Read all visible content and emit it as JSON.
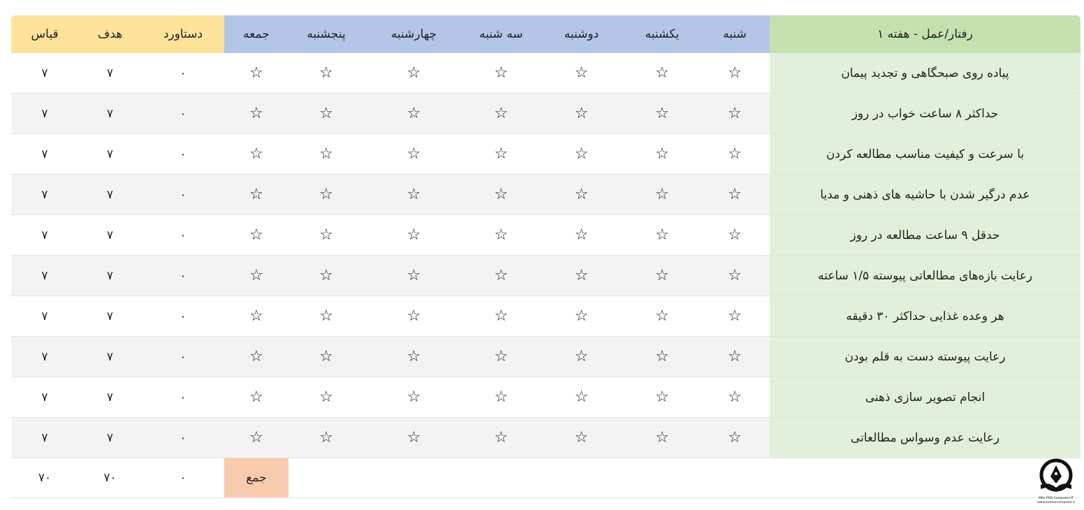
{
  "header": {
    "behavior": "رفتار/عمل - هفته ۱",
    "days": [
      "شنبه",
      "یکشنبه",
      "دوشنبه",
      "سه شنبه",
      "چهارشنبه",
      "پنجشنبه",
      "جمعه"
    ],
    "achievement": "دستاورد",
    "goal": "هدف",
    "measure": "قیاس"
  },
  "rows": [
    {
      "behavior": "پیاده روی صبحگاهی و تجدید پیمان",
      "achievement": "۰",
      "goal": "۷",
      "measure": "۷"
    },
    {
      "behavior": "حداکثر ۸ ساعت خواب در روز",
      "achievement": "۰",
      "goal": "۷",
      "measure": "۷"
    },
    {
      "behavior": "با سرعت و کیفیت مناسب مطالعه کردن",
      "achievement": "۰",
      "goal": "۷",
      "measure": "۷"
    },
    {
      "behavior": "عدم درگیر شدن با حاشیه های ذهنی و مدیا",
      "achievement": "۰",
      "goal": "۷",
      "measure": "۷"
    },
    {
      "behavior": "حدقل ۹ ساعت مطالعه در روز",
      "achievement": "۰",
      "goal": "۷",
      "measure": "۷"
    },
    {
      "behavior": "رعایت بازه‌های مطالعاتی پیوسته ۱/۵ ساعته",
      "achievement": "۰",
      "goal": "۷",
      "measure": "۷"
    },
    {
      "behavior": "هر وعده غذایی حداکثر ۳۰ دقیقه",
      "achievement": "۰",
      "goal": "۷",
      "measure": "۷"
    },
    {
      "behavior": "رعایت پیوسته دست به قلم بودن",
      "achievement": "۰",
      "goal": "۷",
      "measure": "۷"
    },
    {
      "behavior": "انجام تصویر سازی ذهنی",
      "achievement": "۰",
      "goal": "۷",
      "measure": "۷"
    },
    {
      "behavior": "رعایت عدم وسواس مطالعاتی",
      "achievement": "۰",
      "goal": "۷",
      "measure": "۷"
    }
  ],
  "star_symbol": "☆",
  "footer": {
    "label": "جمع",
    "achievement": "۰",
    "goal": "۷۰",
    "measure": "۷۰"
  },
  "logo": {
    "line1": "MSc-PhD Computer-IT",
    "line2": "www.konkurcomputer.ir"
  },
  "colors": {
    "behavior_header": "#c5e1b0",
    "behavior_cells": "#e2efda",
    "day_header": "#b3c6e7",
    "score_header": "#fde39a",
    "sum_label": "#f8cbad"
  }
}
